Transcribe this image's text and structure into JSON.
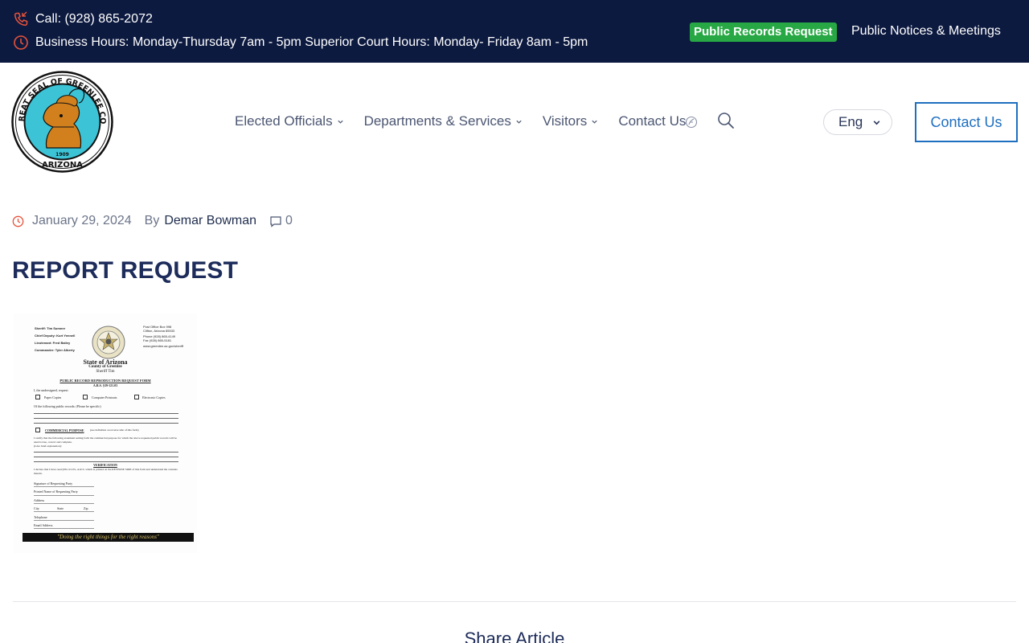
{
  "topbar": {
    "phone": "Call: (928) 865-2072",
    "hours": "Business Hours: Monday-Thursday 7am - 5pm Superior Court Hours: Monday- Friday 8am - 5pm",
    "records_button": "Public Records Request",
    "notices_link": "Public Notices & Meetings",
    "icons": [
      "phone-icon",
      "clock-icon"
    ],
    "records_color": "#27a844",
    "bg_color": "#0d1a40"
  },
  "header": {
    "logo_text": "THE GREAT SEAL OF GREENLEE COUNTY",
    "logo_bottom": "ARIZONA",
    "logo_year": "1909",
    "nav": [
      {
        "label": "Elected Officials",
        "dropdown": true
      },
      {
        "label": "Departments & Services",
        "dropdown": true
      },
      {
        "label": "Visitors",
        "dropdown": true
      },
      {
        "label": "Contact Us",
        "dropdown": false
      }
    ],
    "language": "Eng",
    "cta": "Contact Us",
    "accent_color": "#1e6fc0"
  },
  "post": {
    "date": "January 29, 2024",
    "by_label": "By",
    "author": "Demar Bowman",
    "comments": "0",
    "title": "REPORT REQUEST"
  },
  "document": {
    "header_left": [
      "Sheriff: Tim Sumner",
      "Chief Deputy: Kurt Yennell",
      "Lieutenant: Fred Bailey",
      "Commander: Tyler Alberty"
    ],
    "header_right": [
      "Post Office Box 998",
      "Clifton, Arizona 85533",
      "Phone (928) 865-4149",
      "Fax (928) 865-5181",
      "www.greenlee.az.gov/sheriff"
    ],
    "state": "State of Arizona",
    "county": "County of Greenlee",
    "sheriff": "Sheriff Tim",
    "form_title": "PUBLIC RECORD REPRODUCTION REQUEST FORM",
    "ars": "A.R.S. §39-121.03",
    "request_line": "I, the undersigned, request:",
    "options": [
      "Paper Copies",
      "Computer Printouts",
      "Electronic Copies"
    ],
    "records_line": "Of the following public records: (Please be specific)",
    "commercial": "COMMERCIAL PURPOSE",
    "commercial_note": "(see definition on reverse side of this form)",
    "certify": "I certify that the following statement setting forth the commercial purpose for which the above requested public records will be used is true, correct and complete.",
    "certify2": "(Give brief explanation):",
    "verification": "VERIFICATION",
    "declare": "I declare that I have read §39-121.03., A.R.S. which is printed on the REVERSE SIDE of this form and understand the contents therein.",
    "fields": [
      "Signature of Requesting Party",
      "Printed Name of Requesting Party",
      "Address",
      "City",
      "State",
      "Zip",
      "Telephone",
      "Email Address"
    ],
    "motto": "\"Doing the right things for the right reasons\""
  },
  "share": {
    "label": "Share Article"
  }
}
